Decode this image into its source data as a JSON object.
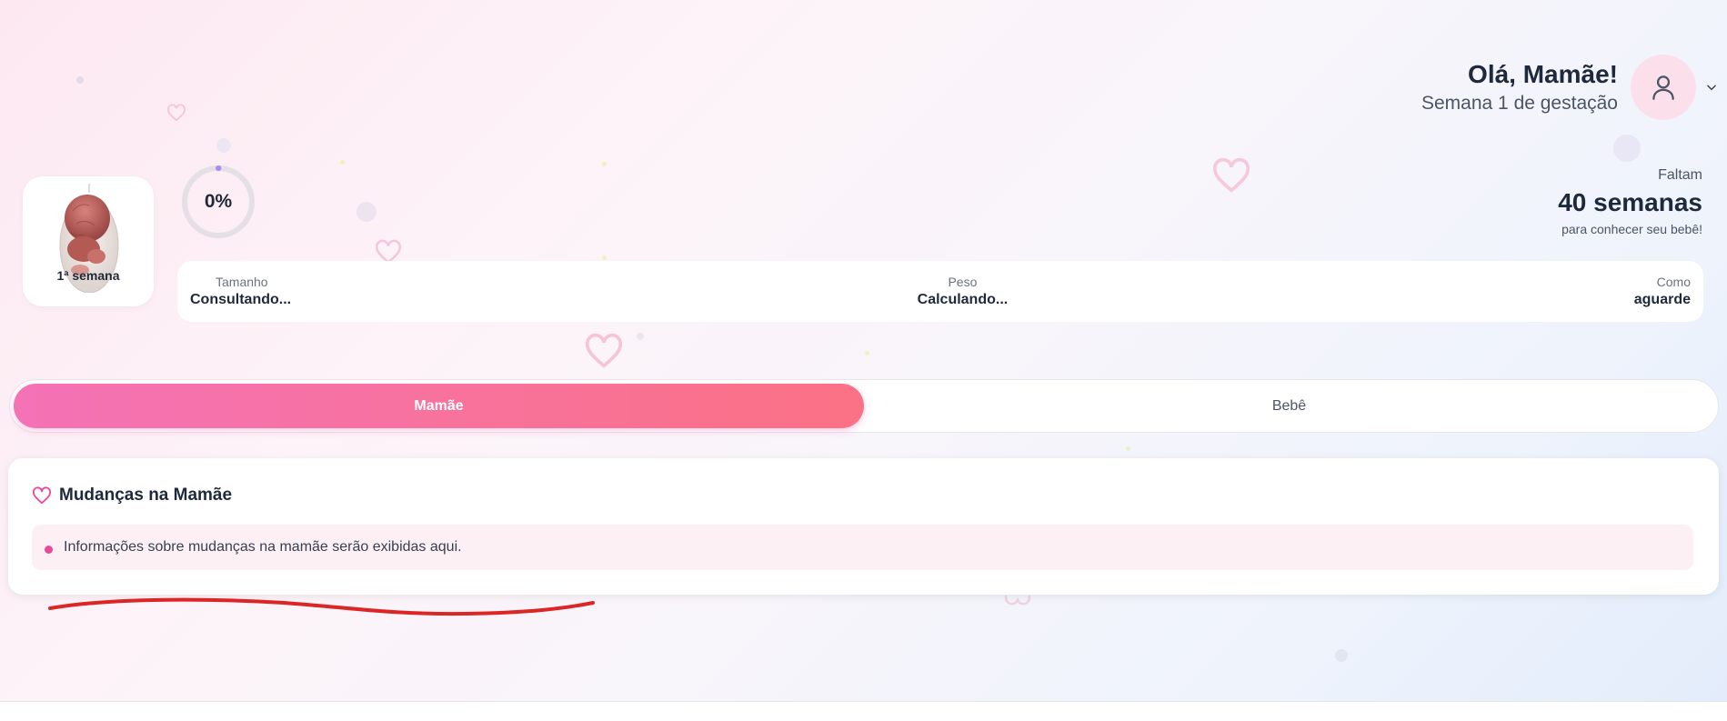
{
  "header": {
    "greeting": "Olá, Mamãe!",
    "subtitle": "Semana 1 de gestação",
    "avatar_icon": "user-icon",
    "chevron_icon": "chevron-down-icon"
  },
  "week_card": {
    "label": "1ª semana",
    "image_icon": "embryo-image"
  },
  "progress": {
    "percent_label": "0%",
    "value": 0,
    "accent": "#a78bfa"
  },
  "remaining": {
    "label": "Faltam",
    "value": "40 semanas",
    "sub": "para conhecer seu bebê!"
  },
  "stats": [
    {
      "label": "Tamanho",
      "value": "Consultando..."
    },
    {
      "label": "Peso",
      "value": "Calculando..."
    },
    {
      "label": "Como",
      "value": "aguarde"
    }
  ],
  "tabs": [
    {
      "label": "Mamãe",
      "active": true
    },
    {
      "label": "Bebê",
      "active": false
    }
  ],
  "card": {
    "icon": "heart-icon",
    "title": "Mudanças na Mamãe",
    "info": "Informações sobre mudanças na mamãe serão exibidas aqui."
  },
  "colors": {
    "accent_pink": "#ec4899",
    "tab_gradient_start": "#f472b6",
    "tab_gradient_end": "#fb7185",
    "annotation_red": "#dc2626"
  }
}
